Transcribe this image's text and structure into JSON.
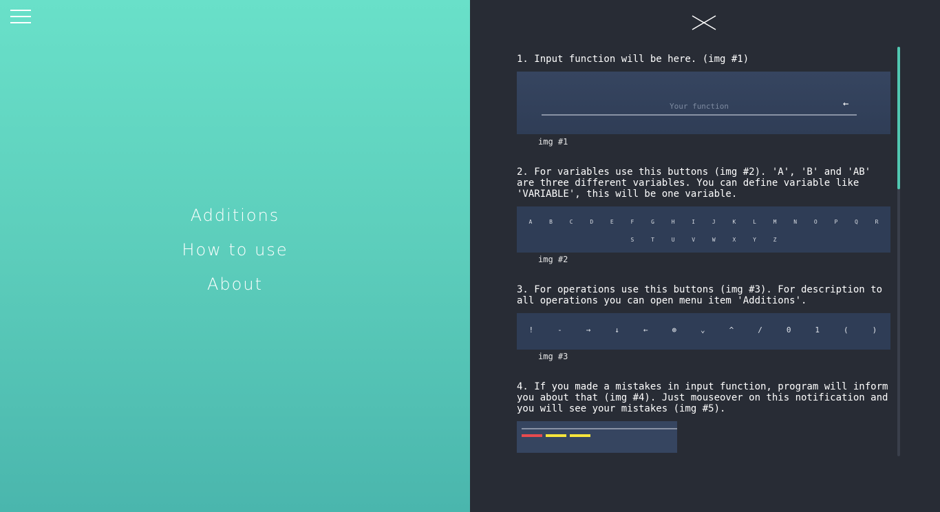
{
  "menu": {
    "items": [
      "Additions",
      "How to use",
      "About"
    ]
  },
  "steps": [
    {
      "text": "1. Input function will be here. (img #1)",
      "caption": "img #1"
    },
    {
      "text": "2. For variables use this buttons (img #2). 'A', 'B' and 'AB' are three different variables. You can define variable like 'VARIABLE', this will be one variable.",
      "caption": "img #2"
    },
    {
      "text": "3. For operations use this buttons (img #3). For description to all operations you can open menu item 'Additions'.",
      "caption": "img #3"
    },
    {
      "text": "4. If you made a mistakes in input function, program will inform you about that (img #4). Just mouseover on this notification and you will see your mistakes (img #5)."
    }
  ],
  "img1": {
    "placeholder": "Your function",
    "arrow": "←"
  },
  "img2": {
    "row1": [
      "A",
      "B",
      "C",
      "D",
      "E",
      "F",
      "G",
      "H",
      "I",
      "J",
      "K",
      "L",
      "M",
      "N",
      "O",
      "P",
      "Q",
      "R"
    ],
    "row2": [
      "S",
      "T",
      "U",
      "V",
      "W",
      "X",
      "Y",
      "Z"
    ]
  },
  "img3": {
    "ops": [
      "!",
      "-",
      "→",
      "↓",
      "←",
      "⊕",
      "⌄",
      "^",
      "/",
      "0",
      "1",
      "(",
      ")"
    ]
  },
  "colors": {
    "accent": "#51c8b2",
    "panel_dark": "#282c35",
    "error": "#e74a4f",
    "warning": "#f5e53b"
  }
}
